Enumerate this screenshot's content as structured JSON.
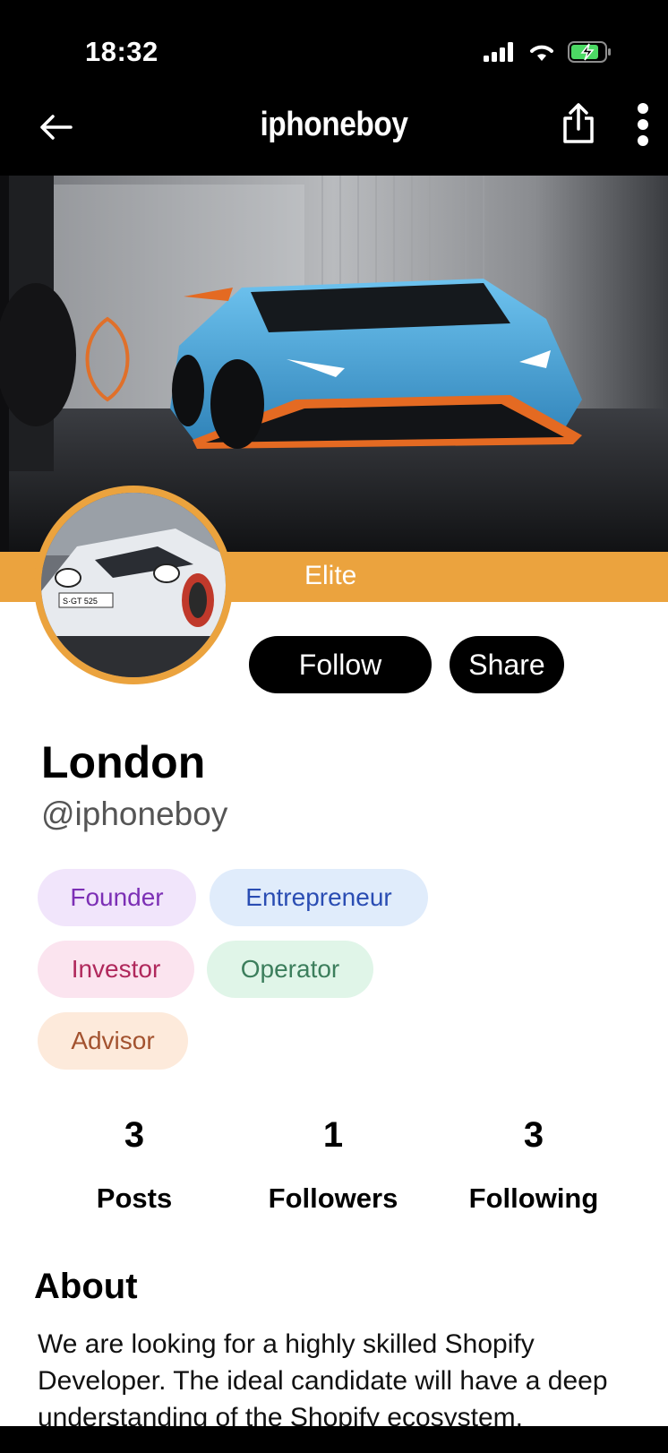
{
  "status_bar": {
    "time": "18:32"
  },
  "nav": {
    "title": "iphoneboy"
  },
  "profile": {
    "badge": "Elite",
    "name": "London",
    "handle": "@iphoneboy",
    "follow_label": "Follow",
    "share_label": "Share"
  },
  "tags": [
    "Founder",
    "Entrepreneur",
    "Investor",
    "Operator",
    "Advisor"
  ],
  "stats": [
    {
      "value": "3",
      "label": "Posts"
    },
    {
      "value": "1",
      "label": "Followers"
    },
    {
      "value": "3",
      "label": "Following"
    }
  ],
  "about": {
    "heading": "About",
    "body": "We are looking for a highly skilled Shopify Developer. The ideal candidate will have a deep understanding of the Shopify ecosystem,"
  },
  "colors": {
    "accent": "#eba33e",
    "background": "#ffffff",
    "topbar": "#000000"
  }
}
